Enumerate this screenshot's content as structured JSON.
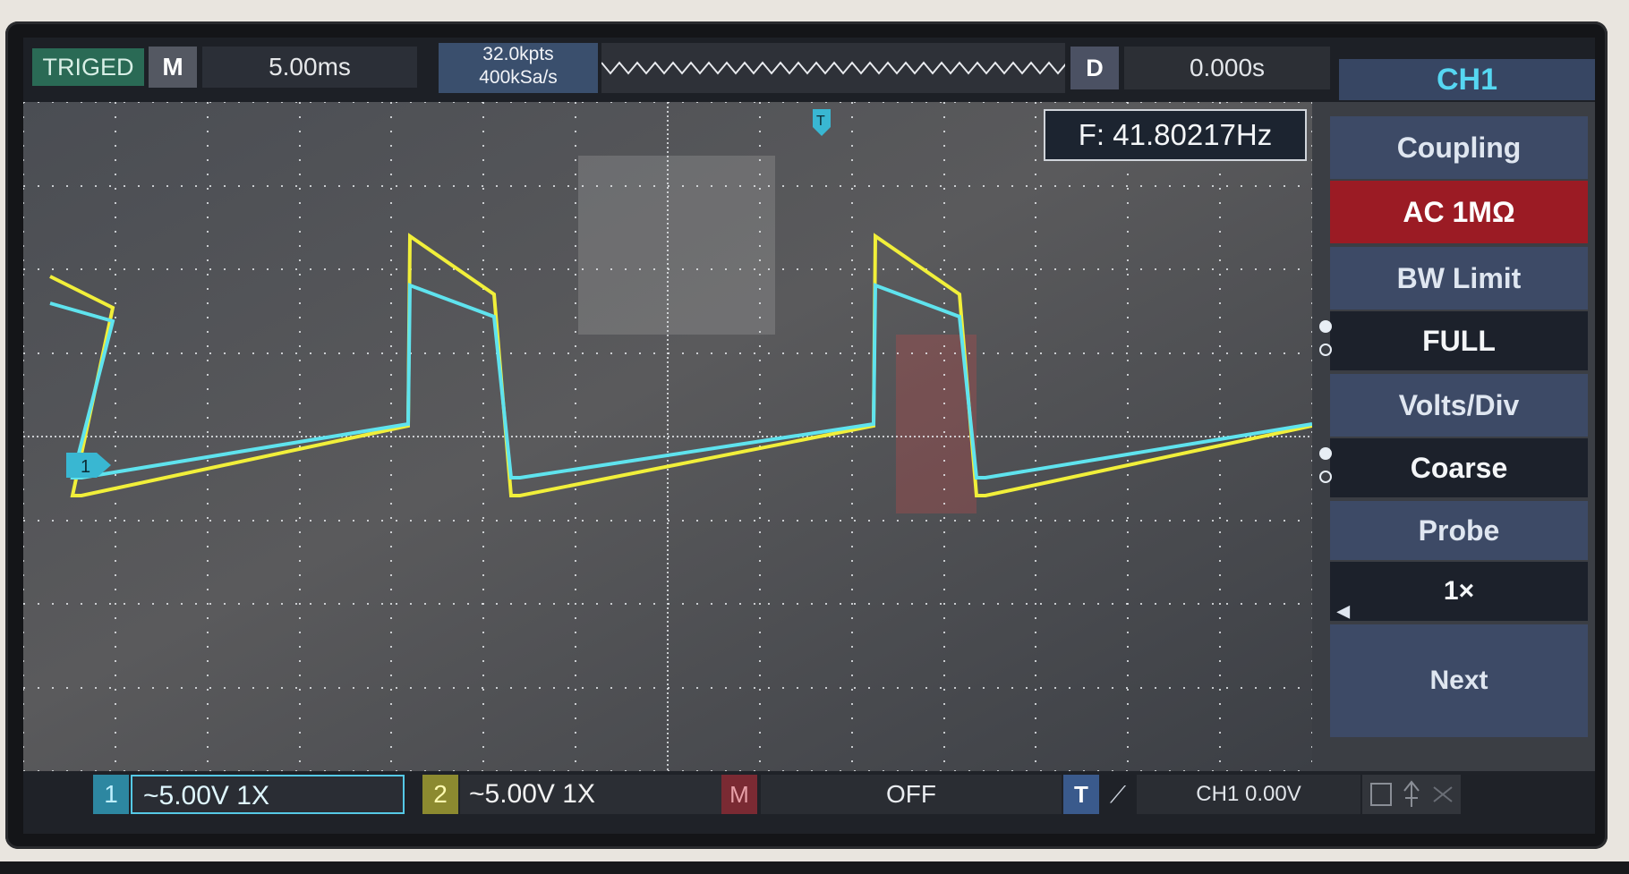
{
  "topbar": {
    "trigger_status": "TRIGED",
    "mode": "M",
    "timebase": "5.00ms",
    "memory_depth": "32.0kpts",
    "sample_rate": "400kSa/s",
    "delay_label": "D",
    "trigger_position": "0.000s",
    "channel_title": "CH1"
  },
  "measurement": {
    "frequency": "F: 41.80217Hz"
  },
  "menu": {
    "coupling_label": "Coupling",
    "coupling_value": "AC 1MΩ",
    "bw_label": "BW Limit",
    "bw_value": "FULL",
    "volts_label": "Volts/Div",
    "volts_value": "Coarse",
    "probe_label": "Probe",
    "probe_value": "1×",
    "next_label": "Next"
  },
  "bottombar": {
    "ch1_number": "1",
    "ch1_scale": "~5.00V  1X",
    "ch2_number": "2",
    "ch2_scale": "~5.00V  1X",
    "math_label": "M",
    "math_value": "OFF",
    "trigger_label": "T",
    "trigger_level": "CH1 0.00V"
  },
  "markers": {
    "ch1_ground": "1",
    "trigger_time": "T"
  },
  "colors": {
    "ch1": "#5fe3ee",
    "ch2": "#f1ef3a",
    "grid": "#e9ecef",
    "menu_selected": "#9b1b24",
    "menu_header": "#3d4a66"
  }
}
